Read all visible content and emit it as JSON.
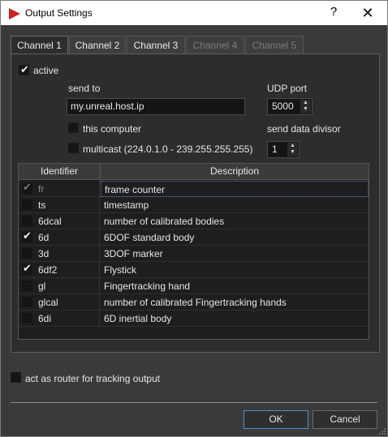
{
  "window": {
    "title": "Output Settings",
    "help_glyph": "?",
    "close_glyph": "✕",
    "accent": "#cc2222"
  },
  "tabs": [
    {
      "label": "Channel 1",
      "state": "active"
    },
    {
      "label": "Channel 2",
      "state": "normal"
    },
    {
      "label": "Channel 3",
      "state": "normal"
    },
    {
      "label": "Channel 4",
      "state": "disabled"
    },
    {
      "label": "Channel 5",
      "state": "disabled"
    }
  ],
  "channel": {
    "active_label": "active",
    "active_checked": true,
    "send_to_label": "send to",
    "send_to_value": "my.unreal.host.ip",
    "udp_port_label": "UDP port",
    "udp_port_value": "5000",
    "this_computer_label": "this computer",
    "this_computer_checked": false,
    "multicast_label": "multicast (224.0.1.0 - 239.255.255.255)",
    "multicast_checked": false,
    "divisor_label": "send data divisor",
    "divisor_value": "1"
  },
  "table": {
    "headers": [
      "Identifier",
      "Description"
    ],
    "rows": [
      {
        "id": "fr",
        "description": "frame counter",
        "checked": true,
        "disabled": true,
        "selected": true
      },
      {
        "id": "ts",
        "description": "timestamp",
        "checked": false,
        "disabled": false,
        "selected": false
      },
      {
        "id": "6dcal",
        "description": "number of calibrated bodies",
        "checked": false,
        "disabled": false,
        "selected": false
      },
      {
        "id": "6d",
        "description": "6DOF standard body",
        "checked": true,
        "disabled": false,
        "selected": false
      },
      {
        "id": "3d",
        "description": "3DOF marker",
        "checked": false,
        "disabled": false,
        "selected": false
      },
      {
        "id": "6df2",
        "description": "Flystick",
        "checked": true,
        "disabled": false,
        "selected": false
      },
      {
        "id": "gl",
        "description": "Fingertracking hand",
        "checked": false,
        "disabled": false,
        "selected": false
      },
      {
        "id": "glcal",
        "description": "number of calibrated Fingertracking hands",
        "checked": false,
        "disabled": false,
        "selected": false
      },
      {
        "id": "6di",
        "description": "6D inertial body",
        "checked": false,
        "disabled": false,
        "selected": false
      }
    ]
  },
  "router_label": "act as router for tracking output",
  "router_checked": false,
  "buttons": {
    "ok": "OK",
    "cancel": "Cancel"
  }
}
